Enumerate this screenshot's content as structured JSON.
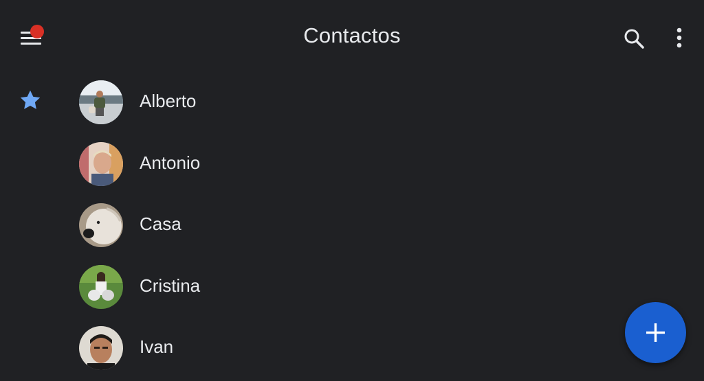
{
  "app": {
    "title": "Contactos"
  },
  "header": {
    "menu_icon": "menu-icon",
    "notification_dot_color": "#d93025",
    "search_icon": "search-icon",
    "more_icon": "more-vert-icon"
  },
  "sidebar": {
    "favorites_icon": "star-icon",
    "favorites_color": "#6fa8f5"
  },
  "contacts": [
    {
      "name": "Alberto"
    },
    {
      "name": "Antonio"
    },
    {
      "name": "Casa"
    },
    {
      "name": "Cristina"
    },
    {
      "name": "Ivan"
    }
  ],
  "fab": {
    "icon": "plus-icon",
    "color": "#1a5fd0"
  },
  "colors": {
    "background": "#202124",
    "text": "#e8eaed"
  }
}
